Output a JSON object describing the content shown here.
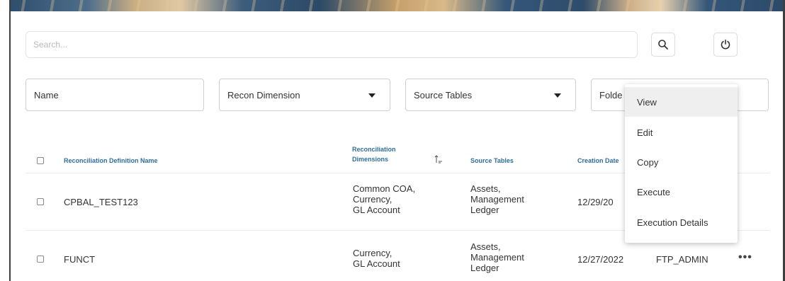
{
  "search": {
    "placeholder": "Search..."
  },
  "toolbar": {
    "search_icon": "search-icon",
    "reset_icon": "power-icon"
  },
  "filters": {
    "name": "Name",
    "recon_dimension": "Recon Dimension",
    "source_tables": "Source Tables",
    "folder": "Folde"
  },
  "table": {
    "headers": {
      "name": "Reconciliation Definition Name",
      "dimensions": [
        "Reconciliation",
        "Dimensions"
      ],
      "source_tables": "Source Tables",
      "creation_date": "Creation Date"
    },
    "rows": [
      {
        "name": "CPBAL_TEST123",
        "dimensions": [
          "Common COA,",
          "Currency,",
          "GL Account"
        ],
        "source_tables": [
          "Assets,",
          "Management",
          "Ledger"
        ],
        "creation_date": "12/29/20",
        "owner": ""
      },
      {
        "name": "FUNCT",
        "dimensions": [
          "Currency,",
          "GL Account"
        ],
        "source_tables": [
          "Assets,",
          "Management",
          "Ledger"
        ],
        "creation_date": "12/27/2022",
        "owner": "FTP_ADMIN"
      }
    ]
  },
  "context_menu": {
    "items": [
      "View",
      "Edit",
      "Copy",
      "Execute",
      "Execution Details"
    ],
    "highlighted": "View"
  },
  "row_actions": "•••"
}
